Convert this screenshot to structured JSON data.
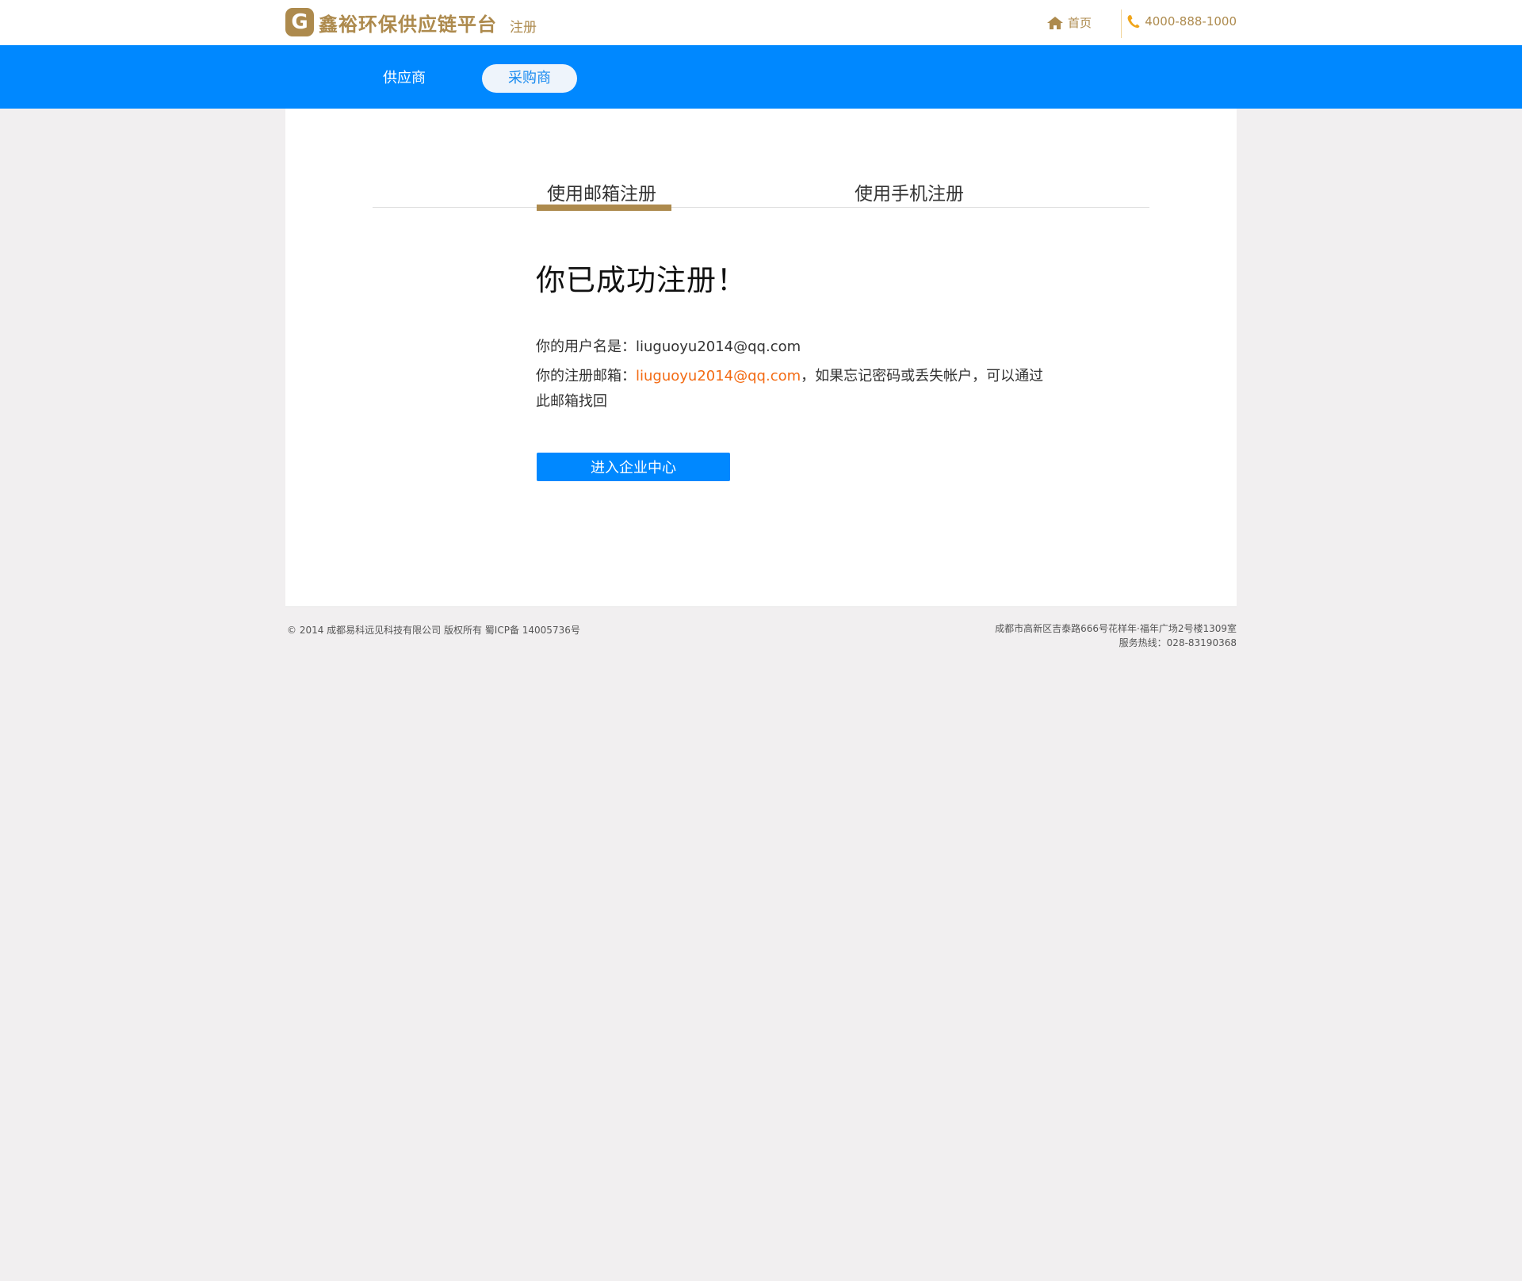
{
  "header": {
    "logo_letter": "G",
    "brand": "鑫裕环保供应链平台",
    "page_label": "注册",
    "home_label": "首页",
    "phone": "4000-888-1000",
    "accent_color": "#ad8a4d"
  },
  "nav": {
    "tabs": [
      {
        "label": "供应商",
        "active": false
      },
      {
        "label": "采购商",
        "active": true
      }
    ],
    "bar_color": "#0088ff"
  },
  "register_tabs": [
    {
      "label": "使用邮箱注册",
      "active": true
    },
    {
      "label": "使用手机注册",
      "active": false
    }
  ],
  "result": {
    "title": "你已成功注册！",
    "username_prefix": "你的用户名是：",
    "username": "liuguoyu2014@qq.com",
    "email_prefix": "你的注册邮箱：",
    "email": "liuguoyu2014@qq.com",
    "email_suffix": "，如果忘记密码或丢失帐户，可以通过此邮箱找回",
    "email_color": "#f36b14",
    "button_label": "进入企业中心"
  },
  "footer": {
    "copyright": "© 2014 成都易科远见科技有限公司 版权所有 蜀ICP备 14005736号",
    "address": "成都市高新区吉泰路666号花样年·福年广场2号楼1309室",
    "hotline": "服务热线：028-83190368"
  }
}
